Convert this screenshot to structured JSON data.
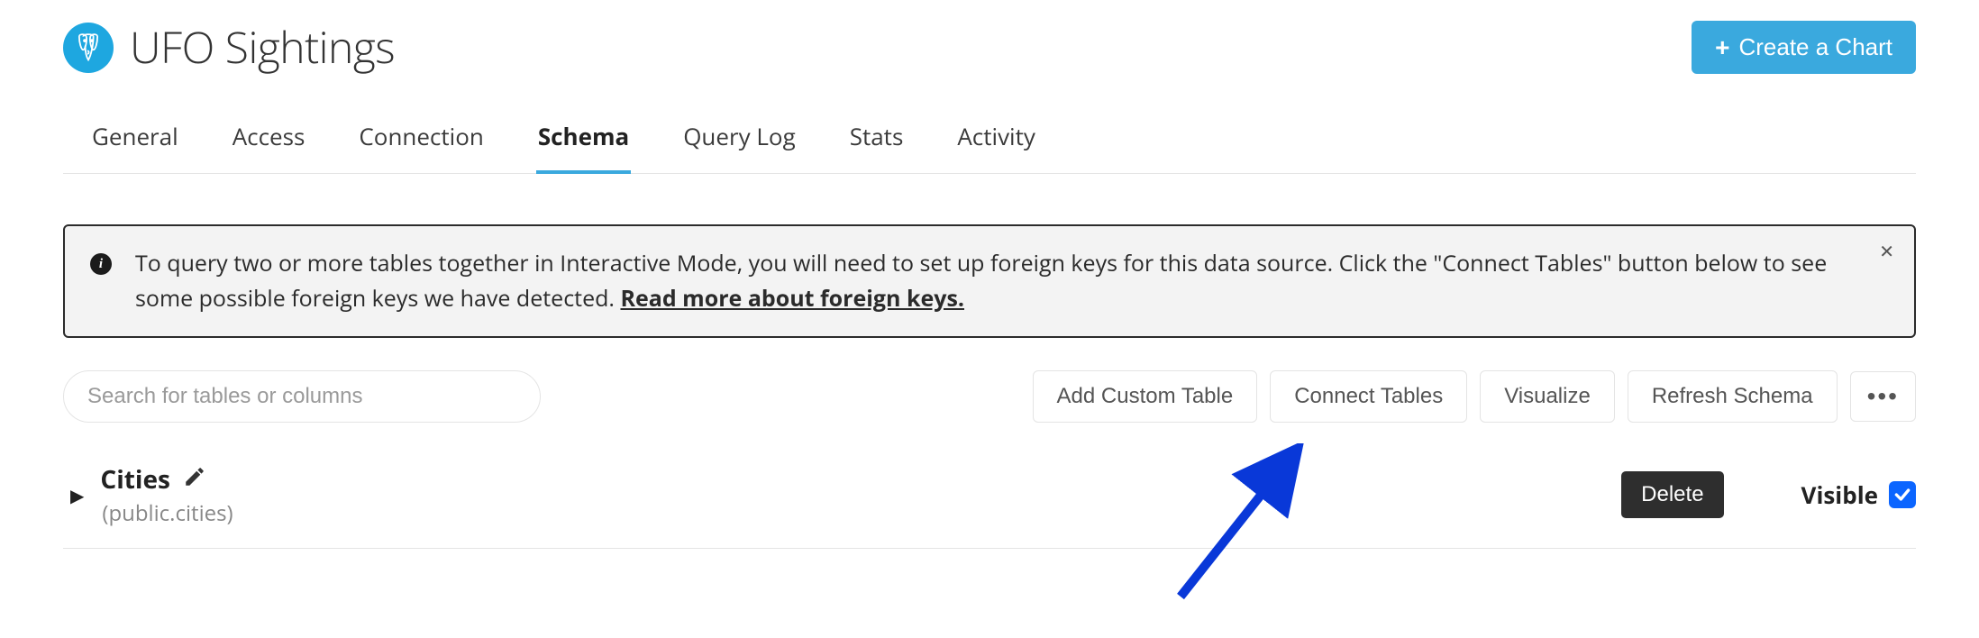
{
  "header": {
    "title": "UFO Sightings",
    "create_chart_label": "Create a Chart"
  },
  "tabs": {
    "items": [
      {
        "label": "General",
        "active": false
      },
      {
        "label": "Access",
        "active": false
      },
      {
        "label": "Connection",
        "active": false
      },
      {
        "label": "Schema",
        "active": true
      },
      {
        "label": "Query Log",
        "active": false
      },
      {
        "label": "Stats",
        "active": false
      },
      {
        "label": "Activity",
        "active": false
      }
    ]
  },
  "banner": {
    "text_before_link": "To query two or more tables together in Interactive Mode, you will need to set up foreign keys for this data source. Click the \"Connect Tables\" button below to see some possible foreign keys we have detected. ",
    "link_text": "Read more about foreign keys."
  },
  "toolbar": {
    "search_placeholder": "Search for tables or columns",
    "add_custom_table": "Add Custom Table",
    "connect_tables": "Connect Tables",
    "visualize": "Visualize",
    "refresh_schema": "Refresh Schema"
  },
  "tables": [
    {
      "name": "Cities",
      "qualified": "(public.cities)",
      "delete_label": "Delete",
      "visible_label": "Visible",
      "visible": true
    }
  ]
}
